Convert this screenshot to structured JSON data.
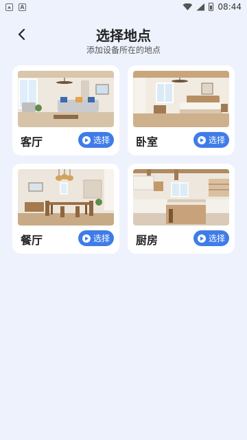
{
  "status_bar": {
    "time": "08:44",
    "icons": [
      "image-icon",
      "a-icon",
      "wifi-icon",
      "signal-icon",
      "battery-icon"
    ]
  },
  "header": {
    "back_icon": "chevron-left-icon",
    "title": "选择地点",
    "subtitle": "添加设备所在的地点"
  },
  "rooms": [
    {
      "name": "客厅",
      "button_label": "选择",
      "photo": "living-room-photo"
    },
    {
      "name": "卧室",
      "button_label": "选择",
      "photo": "bedroom-photo"
    },
    {
      "name": "餐厅",
      "button_label": "选择",
      "photo": "dining-room-photo"
    },
    {
      "name": "厨房",
      "button_label": "选择",
      "photo": "kitchen-photo"
    }
  ],
  "colors": {
    "background": "#eef2fd",
    "card": "#ffffff",
    "accent": "#3f7ce8",
    "title": "#222222"
  }
}
